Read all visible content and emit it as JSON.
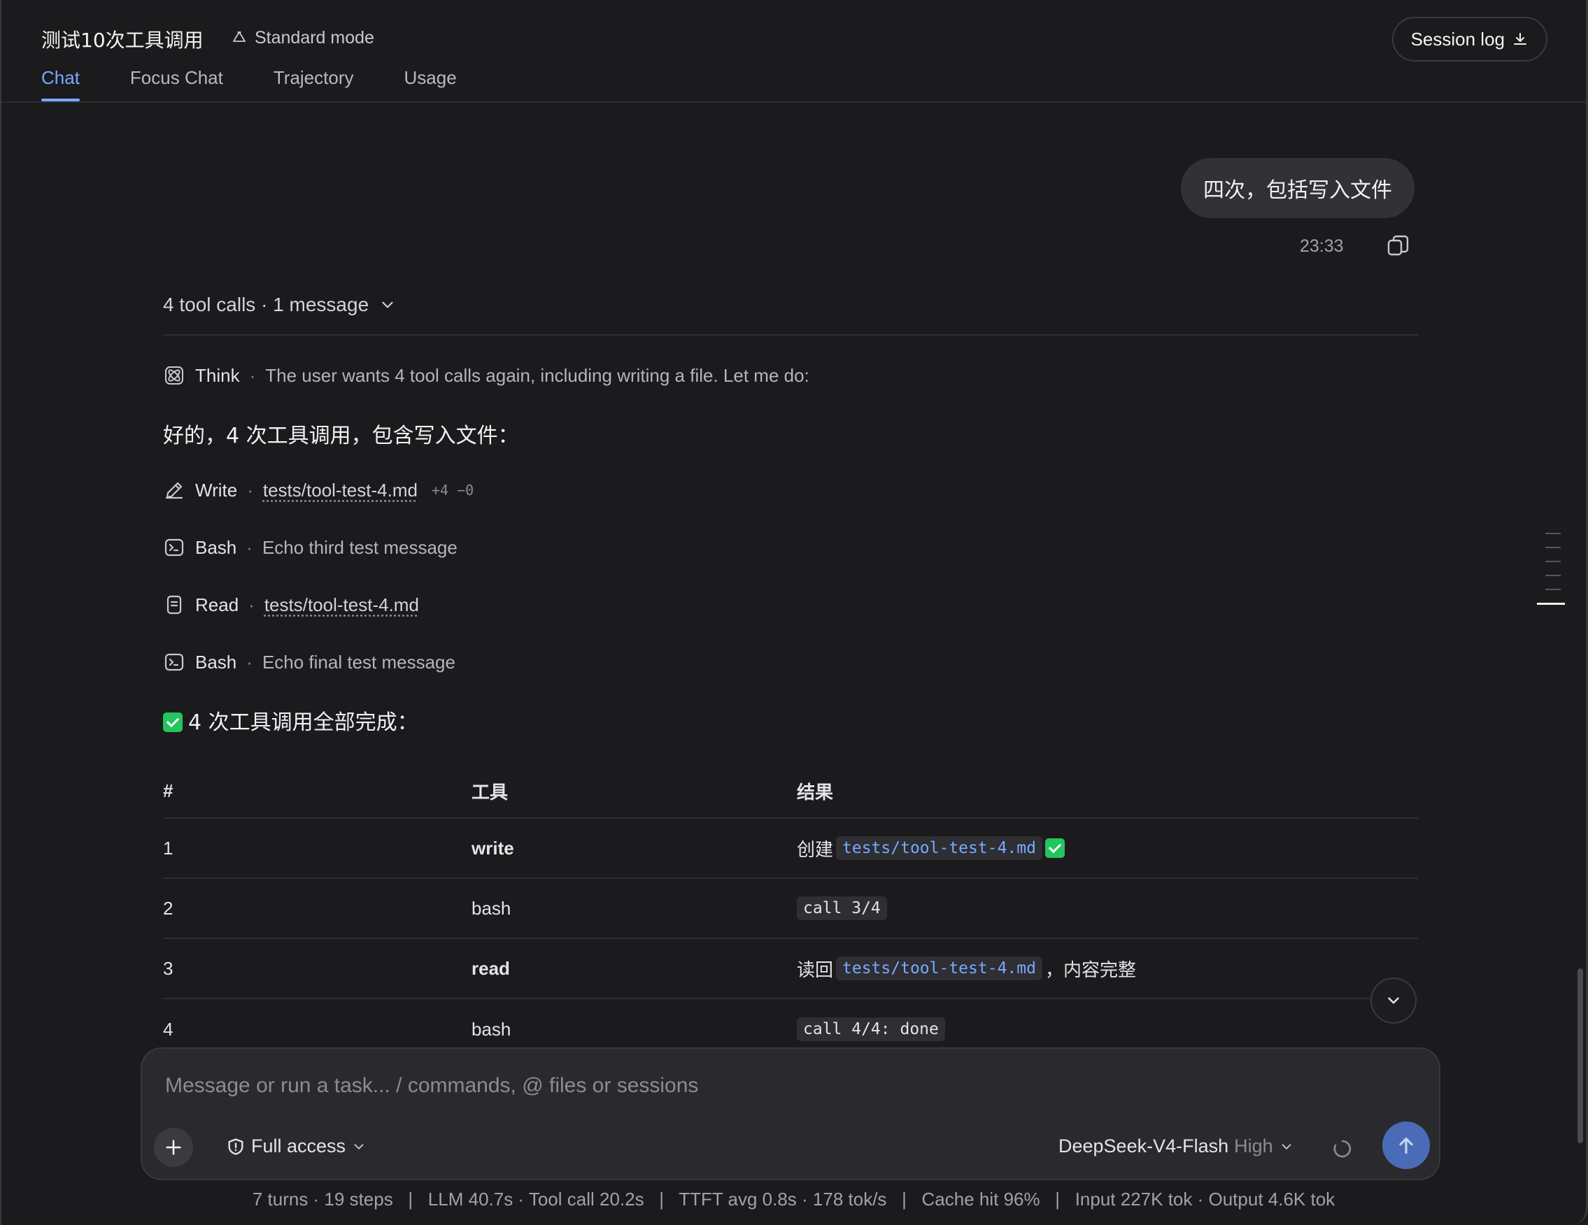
{
  "header": {
    "title": "测试10次工具调用",
    "mode": "Standard mode",
    "session_log": "Session log",
    "tabs": [
      "Chat",
      "Focus Chat",
      "Trajectory",
      "Usage"
    ]
  },
  "user_message": {
    "text": "四次，包括写入文件",
    "time": "23:33"
  },
  "tool_summary": "4 tool calls · 1 message",
  "think": {
    "label": "Think",
    "text": "The user wants 4 tool calls again, including writing a file. Let me do:"
  },
  "intro": "好的，4 次工具调用，包含写入文件：",
  "steps": [
    {
      "tool": "Write",
      "path": "tests/tool-test-4.md",
      "diff": "+4 −0",
      "icon": "pencil-icon"
    },
    {
      "tool": "Bash",
      "desc": "Echo third test message",
      "icon": "terminal-icon"
    },
    {
      "tool": "Read",
      "path": "tests/tool-test-4.md",
      "icon": "file-icon"
    },
    {
      "tool": "Bash",
      "desc": "Echo final test message",
      "icon": "terminal-icon"
    }
  ],
  "done_text": "4 次工具调用全部完成：",
  "table": {
    "headers": [
      "#",
      "工具",
      "结果"
    ],
    "rows": [
      {
        "num": "1",
        "tool": "write",
        "pre": "创建",
        "code": "tests/tool-test-4.md",
        "post": "✅"
      },
      {
        "num": "2",
        "tool": "bash",
        "code": "call 3/4"
      },
      {
        "num": "3",
        "tool": "read",
        "pre": "读回",
        "code": "tests/tool-test-4.md",
        "post": "，内容完整"
      },
      {
        "num": "4",
        "tool": "bash",
        "code": "call 4/4: done"
      }
    ]
  },
  "composer": {
    "placeholder": "Message or run a task... / commands, @ files or sessions",
    "access": "Full access",
    "model": "DeepSeek-V4-Flash",
    "level": "High"
  },
  "stats": "7 turns · 19 steps   |   LLM 40.7s · Tool call 20.2s   |   TTFT avg 0.8s · 178 tok/s   |   Cache hit 96%   |   Input 227K tok · Output 4.6K tok",
  "colors": {
    "accent": "#7aa8ff",
    "background": "#1b1b1d",
    "success": "#22c55e"
  }
}
